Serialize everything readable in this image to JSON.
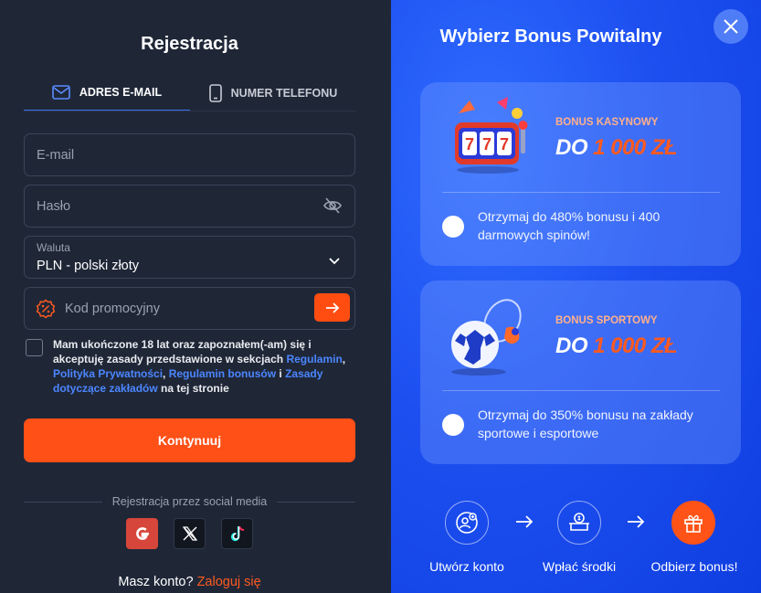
{
  "registration": {
    "title": "Rejestracja",
    "tabs": [
      {
        "label": "ADRES E-MAIL",
        "icon": "mail-icon",
        "active": true
      },
      {
        "label": "NUMER TELEFONU",
        "icon": "phone-icon",
        "active": false
      }
    ],
    "email_placeholder": "E-mail",
    "password_placeholder": "Hasło",
    "currency_label": "Waluta",
    "currency_value": "PLN - polski złoty",
    "promo_placeholder": "Kod promocyjny",
    "agree": {
      "text1": "Mam ukończone 18 lat oraz zapoznałem(-am) się i akceptuję zasady przedstawione w sekcjach ",
      "link1": "Regulamin",
      "sep1": ", ",
      "link2": "Polityka Prywatności",
      "sep2": ", ",
      "link3": "Regulamin bonusów",
      "sep3": " i ",
      "link4": "Zasady dotyczące zakładów",
      "text2": " na tej stronie"
    },
    "continue_label": "Kontynuuj",
    "social_title": "Rejestracja przez social media",
    "social": [
      "google-icon",
      "x-icon",
      "tiktok-icon"
    ],
    "login_prefix": "Masz konto?",
    "login_link": "Zaloguj się"
  },
  "bonus": {
    "title": "Wybierz Bonus Powitalny",
    "cards": [
      {
        "category": "BONUS KASYNOWY",
        "amount_prefix": "DO",
        "amount_value": "1 000 ZŁ",
        "description": "Otrzymaj do 480% bonusu i 400 darmowych spinów!",
        "selected": false,
        "art": "slot-machine-art"
      },
      {
        "category": "BONUS SPORTOWY",
        "amount_prefix": "DO",
        "amount_value": "1 000 ZŁ",
        "description": "Otrzymaj do 350% bonusu na zakłady sportowe i esportowe",
        "selected": false,
        "art": "sports-ball-art"
      }
    ],
    "steps": [
      {
        "label": "Utwórz konto",
        "icon": "add-user-icon"
      },
      {
        "label": "Wpłać środki",
        "icon": "deposit-icon"
      },
      {
        "label": "Odbierz bonus!",
        "icon": "gift-icon"
      }
    ]
  },
  "colors": {
    "accent_orange": "#ff5017",
    "link_blue": "#4c86ff",
    "panel_dark": "#1f2737",
    "panel_blue": "#1d4ff0"
  }
}
